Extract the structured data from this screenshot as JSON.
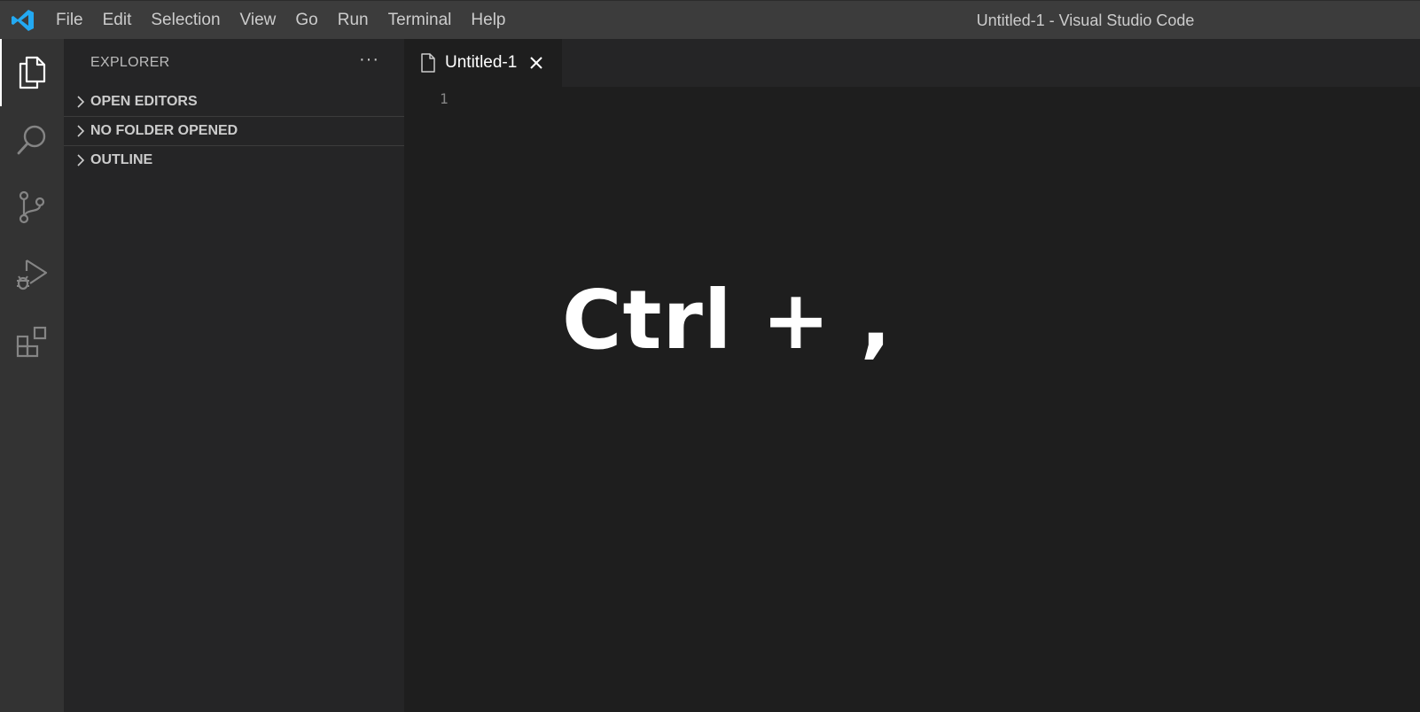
{
  "titlebar": {
    "menu": [
      "File",
      "Edit",
      "Selection",
      "View",
      "Go",
      "Run",
      "Terminal",
      "Help"
    ],
    "window_title": "Untitled-1 - Visual Studio Code",
    "logo_icon": "vscode-logo-icon",
    "logo_color": "#23a9f2"
  },
  "activitybar": {
    "items": [
      {
        "icon": "files-icon",
        "active": true
      },
      {
        "icon": "search-icon",
        "active": false
      },
      {
        "icon": "source-control-icon",
        "active": false
      },
      {
        "icon": "run-debug-icon",
        "active": false
      },
      {
        "icon": "extensions-icon",
        "active": false
      }
    ]
  },
  "sidebar": {
    "title": "EXPLORER",
    "more_icon": "ellipsis-icon",
    "sections": [
      {
        "label": "OPEN EDITORS"
      },
      {
        "label": "NO FOLDER OPENED"
      },
      {
        "label": "OUTLINE"
      }
    ]
  },
  "editor": {
    "tab": {
      "label": "Untitled-1",
      "icon": "file-icon",
      "close_icon": "close-icon"
    },
    "line_numbers": [
      "1"
    ],
    "overlay_text": "Ctrl + ,"
  }
}
